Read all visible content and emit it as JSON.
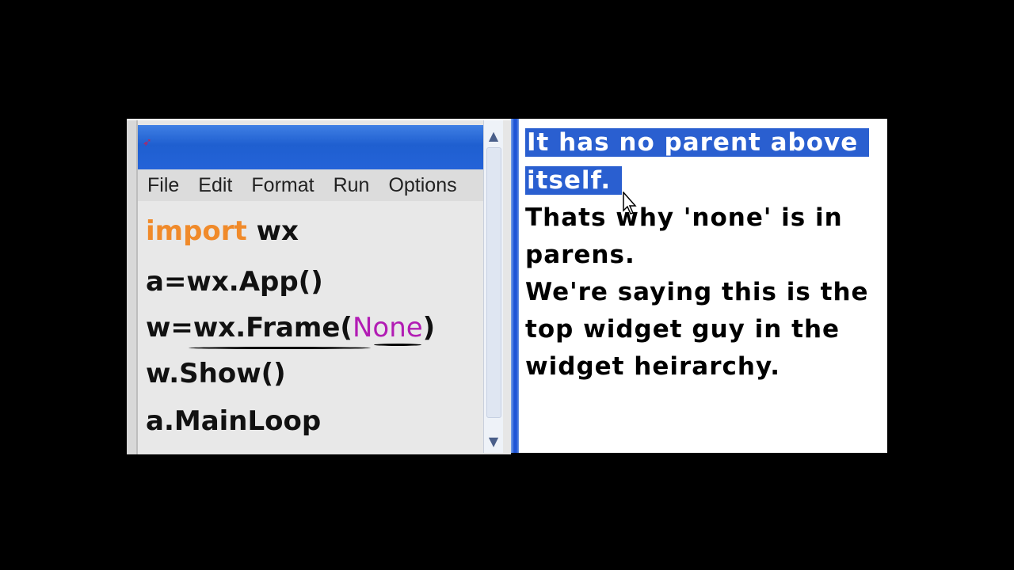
{
  "ide": {
    "menu": [
      "File",
      "Edit",
      "Format",
      "Run",
      "Options"
    ],
    "code": {
      "line1_kw": "import",
      "line1_rest": " wx",
      "line2": "a=wx.App()",
      "line3_pre": "w=wx.Frame(",
      "line3_arg": "None",
      "line3_post": ")",
      "line4": "w.Show()",
      "line5": "a.MainLoop"
    }
  },
  "note": {
    "line1": "It has no parent above",
    "line2": "itself.",
    "line3": "Thats why 'none' is in",
    "line4": "parens.",
    "line5": "We're saying this is the",
    "line6": "top widget guy in the",
    "line7": "widget heirarchy."
  },
  "colors": {
    "titlebar": "#1f5fd0",
    "keyword": "#f08a2a",
    "none_arg": "#b21cb4",
    "selection": "#2a5fd0"
  }
}
